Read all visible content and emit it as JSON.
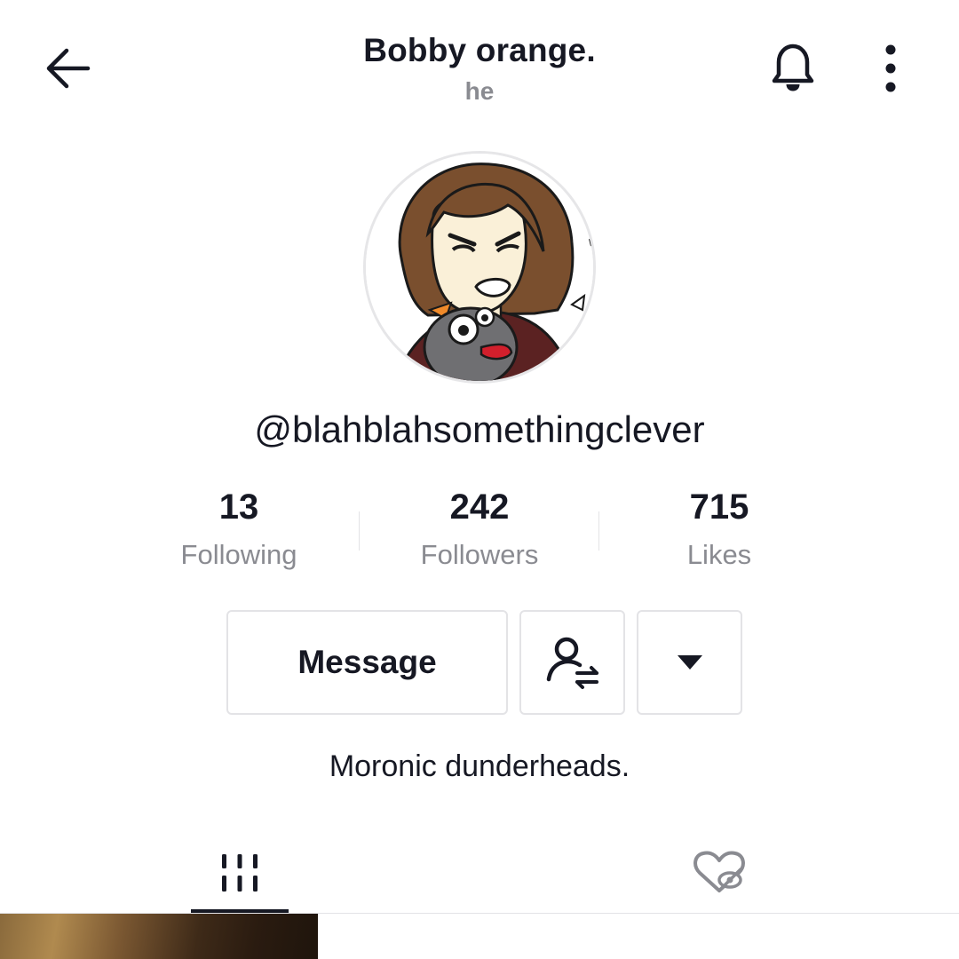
{
  "header": {
    "title": "Bobby orange.",
    "pronoun": "he",
    "back_icon": "arrow-left-icon",
    "notification_icon": "bell-icon",
    "more_icon": "more-vertical-icon"
  },
  "profile": {
    "username": "@blahblahsomethingclever",
    "bio": "Moronic dunderheads."
  },
  "stats": [
    {
      "value": "13",
      "label": "Following"
    },
    {
      "value": "242",
      "label": "Followers"
    },
    {
      "value": "715",
      "label": "Likes"
    }
  ],
  "actions": {
    "message_label": "Message",
    "friends_icon": "user-swap-icon",
    "dropdown_icon": "caret-down-icon"
  },
  "tabs": [
    {
      "name": "videos",
      "icon": "grid-bars-icon",
      "active": true
    },
    {
      "name": "liked",
      "icon": "heart-hidden-icon",
      "active": false
    }
  ],
  "colors": {
    "text_primary": "#161823",
    "text_secondary": "#8a8b91",
    "border": "#e3e3e6"
  }
}
